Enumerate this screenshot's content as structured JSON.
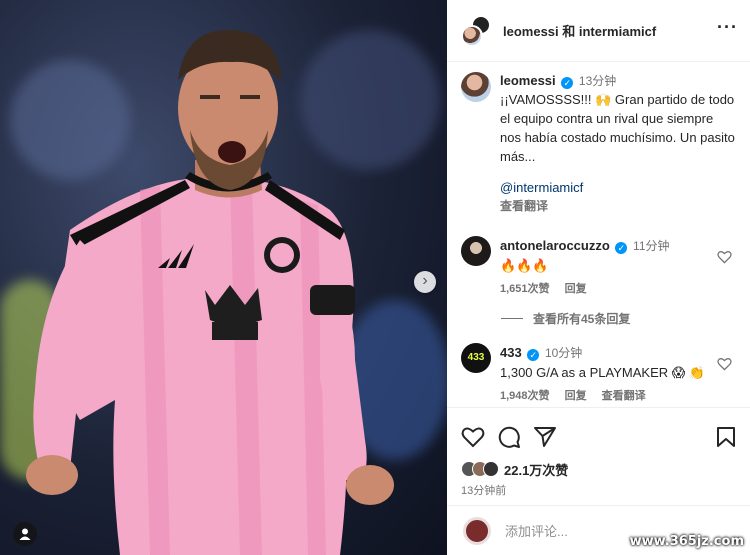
{
  "header": {
    "title": "leomessi 和 intermiamicf"
  },
  "post": {
    "author": "leomessi",
    "time": "13分钟",
    "caption": "¡¡VAMOSSSS!!! 🙌 Gran partido de todo el equipo contra un rival que siempre nos había costado muchísimo. Un pasito más...",
    "mention": "@intermiamicf",
    "translate": "查看翻译"
  },
  "comments": [
    {
      "user": "antonelaroccuzzo",
      "time": "11分钟",
      "text": "🔥🔥🔥",
      "likes": "1,651次赞",
      "reply": "回复",
      "avatar_label": ""
    },
    {
      "user": "433",
      "time": "10分钟",
      "text": "1,300 G/A as a PLAYMAKER 😱 👏",
      "likes": "1,948次赞",
      "reply": "回复",
      "translate": "查看翻译",
      "avatar_label": "433"
    }
  ],
  "view_all": "查看所有45条回复",
  "likes_count": "22.1万次赞",
  "timestamp": "13分钟前",
  "add_comment_placeholder": "添加评论...",
  "watermark": "www.365jz.com",
  "colors": {
    "jersey": "#f4a9c8",
    "verified": "#0095f6",
    "muted": "#737373"
  }
}
